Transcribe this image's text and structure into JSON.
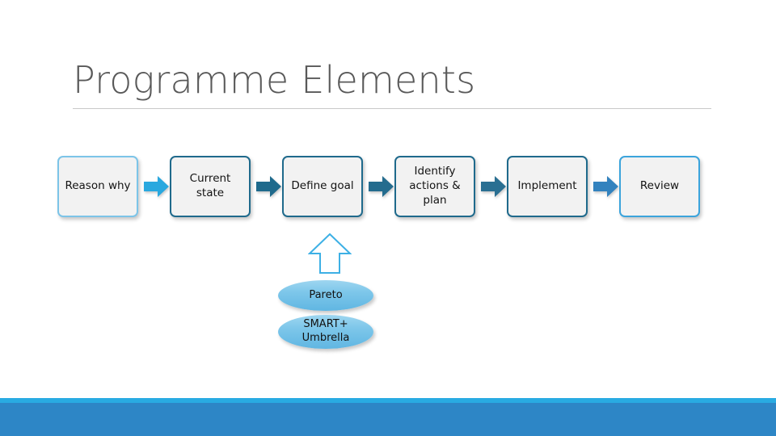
{
  "slide": {
    "title": "Programme Elements",
    "background_color": "#ffffff",
    "title_color": "#595959",
    "rule_color": "#c9c9c9"
  },
  "process": {
    "box_fill": "#f2f2f2",
    "boxes": [
      {
        "label": "Reason why",
        "accent": "#7cc4e8"
      },
      {
        "label": "Current\nstate",
        "accent": "#1f6a8c"
      },
      {
        "label": "Define goal",
        "accent": "#1f6a8c"
      },
      {
        "label": "Identify\nactions &\nplan",
        "accent": "#1f6a8c"
      },
      {
        "label": "Implement",
        "accent": "#1f6a8c"
      },
      {
        "label": "Review",
        "accent": "#3ba4dc"
      }
    ],
    "arrows": [
      {
        "name": "arrow-reason-to-current",
        "color": "#29a8df"
      },
      {
        "name": "arrow-current-to-define",
        "color": "#1f6a8c"
      },
      {
        "name": "arrow-define-to-identify",
        "color": "#246c8e"
      },
      {
        "name": "arrow-identify-to-implement",
        "color": "#2a6f92"
      },
      {
        "name": "arrow-implement-to-review",
        "color": "#3282be"
      }
    ]
  },
  "callouts": {
    "up_arrow": {
      "icon": "arrow-up-outline-icon",
      "stroke_color": "#3db0e5",
      "fill_color": "#ffffff"
    },
    "ellipses": [
      {
        "label": "Pareto",
        "fill": "#7ec7ea"
      },
      {
        "label": "SMART+\nUmbrella",
        "fill": "#7ec7ea"
      }
    ]
  },
  "footer": {
    "thin_strip_color": "#29abe2",
    "band_color": "#2d86c6"
  }
}
